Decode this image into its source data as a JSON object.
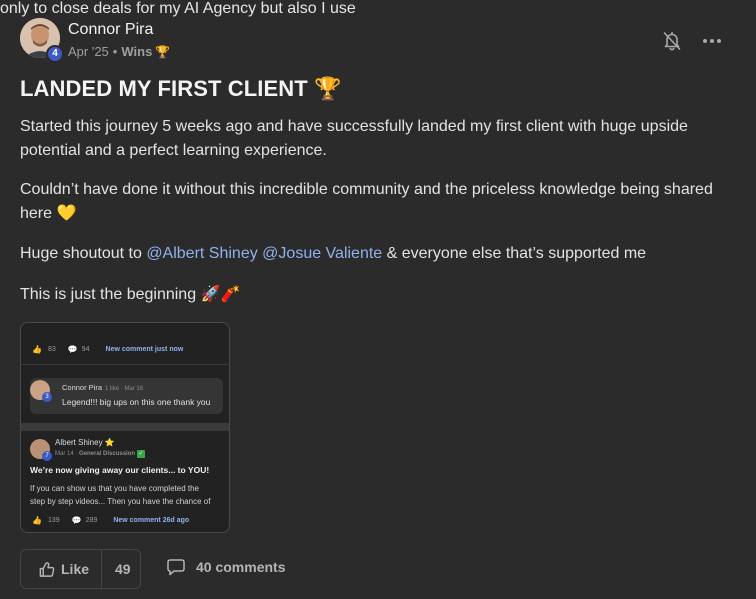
{
  "author": {
    "name": "Connor Pira",
    "level": "4",
    "date": "Apr '25",
    "separator": "•",
    "category": "Wins",
    "category_icon": "🏆"
  },
  "post": {
    "title": "LANDED MY FIRST CLIENT 🏆",
    "p1": "Started this journey 5 weeks ago and have successfully landed my first client with huge upside potential and a perfect learning experience.",
    "p2": "Couldn’t have done it without this incredible community and the priceless knowledge being shared here 💛",
    "p3_before": "Huge shoutout to ",
    "mention1": "@Albert Shiney",
    "mention2": "@Josue Valiente",
    "p3_after": " & everyone else that’s supported me",
    "p4": "This is just the beginning 🚀🧨"
  },
  "embed": {
    "top_text": "only to close deals for my AI Agency but also I use",
    "row1": {
      "likes": "83",
      "comments": "94",
      "new_comment": "New comment just now"
    },
    "comment": {
      "author": "Connor Pira",
      "level": "3",
      "meta": "1 like · Mar 16",
      "text": "Legend!!! big ups on this one thank you"
    },
    "post2": {
      "author": "Albert Shiney ⭐",
      "level": "7",
      "date": "Mar 14 · ",
      "category": "General Discussion",
      "check": "✓",
      "headline": "We’re now giving away our clients... to YOU!",
      "line1": "If you can show us that you have completed the",
      "line2": "step by step videos... Then you have the chance of"
    },
    "row2": {
      "likes": "139",
      "comments": "289",
      "new_comment": "New comment 26d ago"
    }
  },
  "actions": {
    "like_label": "Like",
    "like_count": "49",
    "comments_label": "40 comments"
  },
  "icons": {
    "bell": "bell-off-icon",
    "more": "more-horizontal-icon",
    "like": "thumbs-up-icon",
    "comment": "comment-bubble-icon"
  },
  "colors": {
    "background": "#2b2b2b",
    "mention": "#8fb2ee",
    "level_badge": "#3d59c6"
  }
}
